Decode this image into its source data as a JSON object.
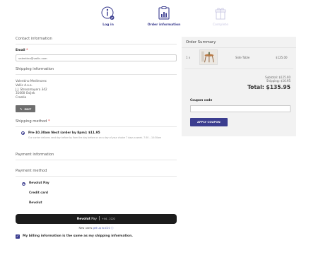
{
  "steps": [
    {
      "label": "Log in",
      "icon": "user-check-icon",
      "active": true
    },
    {
      "label": "Order information",
      "icon": "clipboard-chart-icon",
      "active": true
    },
    {
      "label": "Complete",
      "icon": "gift-icon",
      "active": false
    }
  ],
  "contact": {
    "title": "Contact information",
    "email_label": "Email",
    "email_required": "*",
    "email_value": "valentino@vallic.com"
  },
  "shipping_info": {
    "title": "Shipping information",
    "lines": [
      "Valentino Medimorec",
      "Vallic d.o.o.",
      "J.J. Strossmayera 342",
      "31000 Osijek",
      "Croatia"
    ],
    "edit_label": "EDIT"
  },
  "shipping_method": {
    "title": "Shipping method",
    "required": "*",
    "option_title": "Pre-10.30am Next (order by 8pm): $11.95",
    "option_desc": "Our carrier delivers next day before by 9am the day before or on a day of your choice 7 days a week. 7:30 – 10:30am"
  },
  "payment_info": {
    "title": "Payment information"
  },
  "payment_method": {
    "title": "Payment method",
    "options": [
      "Revolut Pay",
      "Credit card",
      "Revolut"
    ],
    "selected": 0
  },
  "revolut": {
    "button_brand": "Revolut",
    "button_pay": " Pay",
    "button_phone": "+44 - 2222",
    "new_users_text": "New users ",
    "new_users_link": "get up to £20 ⓘ"
  },
  "billing": {
    "label": "My billing information is the same as my shipping information.",
    "checked": true
  },
  "summary": {
    "title": "Order Summary",
    "item": {
      "qty": "1 x",
      "name": "Side Table",
      "price": "$125.00"
    },
    "subtotal": "Subtotal: $125.00",
    "shipping": "Shipping: $10.95",
    "total": "Total: $135.95",
    "coupon_label": "Coupon code",
    "apply_label": "APPLY COUPON"
  },
  "colors": {
    "accent": "#3b3d8f",
    "inactive": "#c9c7e3",
    "dark_button": "#1c1c1c"
  }
}
